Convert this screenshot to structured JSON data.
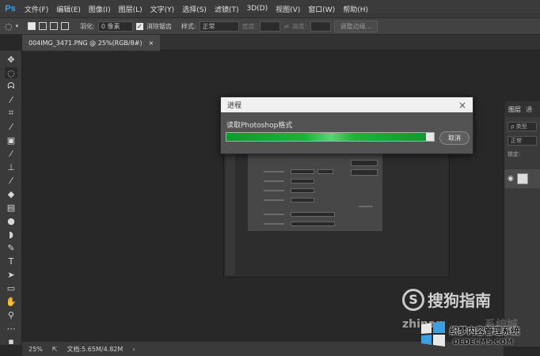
{
  "app": {
    "logo": "Ps"
  },
  "menu": [
    "文件(F)",
    "编辑(E)",
    "图像(I)",
    "图层(L)",
    "文字(Y)",
    "选择(S)",
    "滤镜(T)",
    "3D(D)",
    "视图(V)",
    "窗口(W)",
    "帮助(H)"
  ],
  "options": {
    "feather_label": "羽化:",
    "feather_value": "0 像素",
    "antialias_label": "消除锯齿",
    "style_label": "样式:",
    "style_value": "正常",
    "width_label": "宽度:",
    "height_label": "高度:",
    "refine_label": "调整边缘..."
  },
  "document": {
    "tab_title": "004IMG_3471.PNG @ 25%(RGB/8#)",
    "close": "×"
  },
  "status": {
    "zoom": "25%",
    "doc_size": "文档:5.65M/4.82M"
  },
  "layers_panel": {
    "tab1": "图层",
    "tab2": "通",
    "search_placeholder": "ρ 类型",
    "blend": "正常",
    "lock_label": "锁定:"
  },
  "dialog": {
    "title": "进程",
    "message": "读取Photoshop格式",
    "progress": 0.96,
    "cancel_label": "取消"
  },
  "watermarks": {
    "sogou": "搜狗指南",
    "sogou_mark": "S",
    "zhinan": "zhinan",
    "xitong": "系统城",
    "site_cn": "织梦内容管理系统",
    "site_domain": "DEDECMS.COM"
  },
  "colors": {
    "accent": "#2fa3f5",
    "progress": "#16b63a"
  }
}
